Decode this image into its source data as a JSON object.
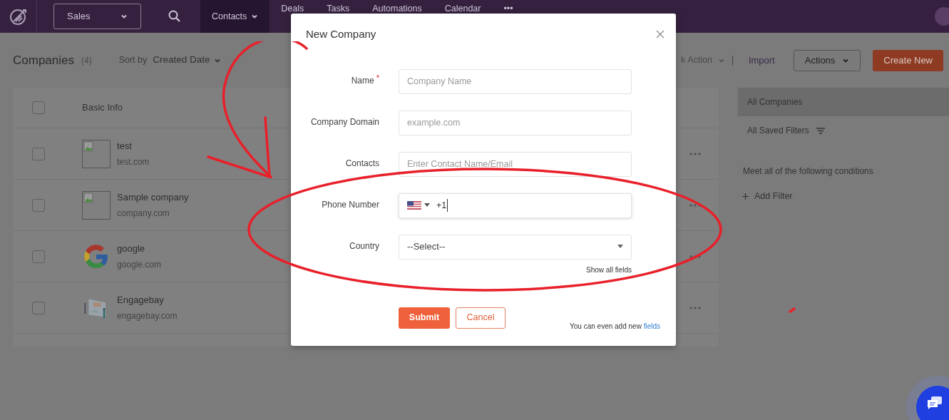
{
  "nav": {
    "workspace": "Sales",
    "tabs": [
      {
        "label": "Contacts",
        "selected": true,
        "caret": true
      },
      {
        "label": "Deals",
        "selected": false,
        "caret": false
      },
      {
        "label": "Tasks",
        "selected": false,
        "caret": false
      },
      {
        "label": "Automations",
        "selected": false,
        "caret": false
      },
      {
        "label": "Calendar",
        "selected": false,
        "caret": false
      },
      {
        "label": "•••",
        "selected": false,
        "caret": false
      }
    ]
  },
  "toolbar": {
    "title": "Companies",
    "count": "(4)",
    "sort_label": "Sort by",
    "sort_value": "Created Date",
    "bulk_action": "k Action",
    "import": "Import",
    "actions": "Actions",
    "create": "Create New"
  },
  "table": {
    "header": "Basic Info",
    "checked": false,
    "rows": [
      {
        "name": "test",
        "domain": "test.com",
        "kind": "broken",
        "checked": false
      },
      {
        "name": "Sample company",
        "domain": "company.com",
        "kind": "broken",
        "checked": false
      },
      {
        "name": "google",
        "domain": "google.com",
        "kind": "google",
        "checked": false
      },
      {
        "name": "Engagebay",
        "domain": "engagebay.com",
        "kind": "picture",
        "checked": false
      }
    ]
  },
  "filters": {
    "items": [
      {
        "label": "All Companies",
        "selected": true
      },
      {
        "label": "All Saved Filters",
        "selected": false
      }
    ],
    "conditions": "Meet all of the following conditions",
    "add_filter": "Add Filter"
  },
  "modal": {
    "title": "New Company",
    "fields": [
      {
        "kind": "text",
        "label": "Name",
        "required_mark": "*",
        "placeholder": "Company Name"
      },
      {
        "kind": "text",
        "label": "Company Domain",
        "placeholder": "example.com"
      },
      {
        "kind": "text",
        "label": "Contacts",
        "placeholder": "Enter Contact Name/Email"
      },
      {
        "kind": "phone",
        "label": "Phone Number",
        "value": "+1"
      },
      {
        "kind": "select",
        "label": "Country",
        "value": "--Select--"
      }
    ],
    "show_all": "Show all fields",
    "submit": "Submit",
    "cancel": "Cancel",
    "hint": "You can even add new",
    "hint_link": "fields"
  }
}
